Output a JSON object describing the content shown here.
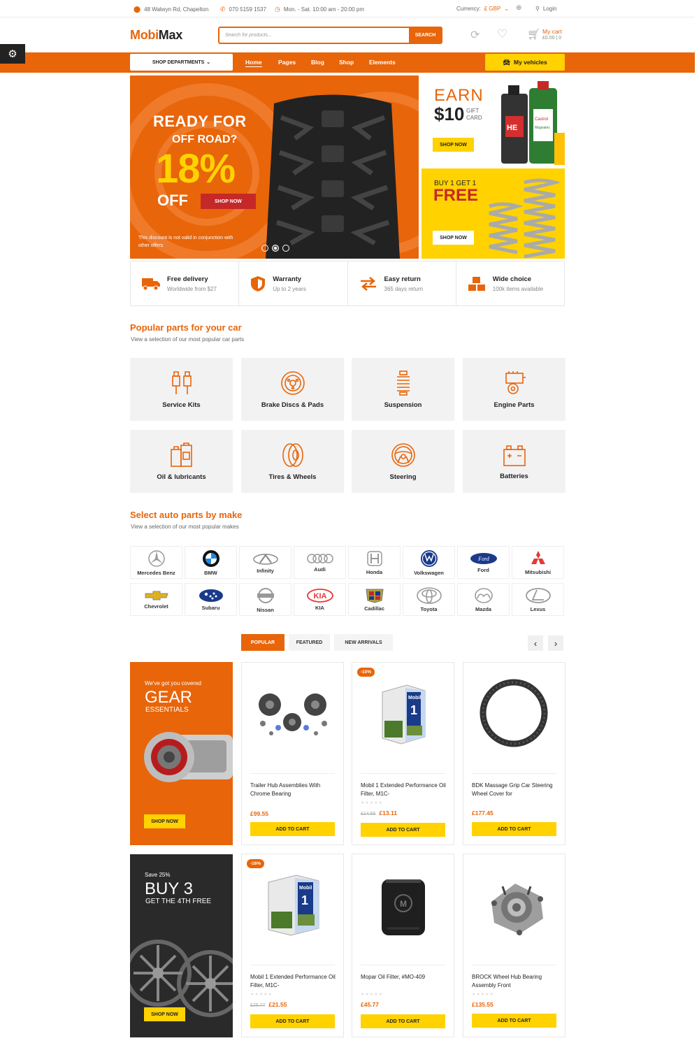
{
  "topbar": {
    "address": "48 Walwyn Rd, Chapelton",
    "phone": "070 5159 1537",
    "hours": "Mon. - Sat. 10:00 am - 20:00 pm",
    "currency_label": "Currency:",
    "currency_value": "£ GBP",
    "login": "Login"
  },
  "header": {
    "logo_a": "Mobi",
    "logo_b": "Max",
    "search_placeholder": "Search for products...",
    "search_button": "SEARCH",
    "cart_label": "My cart",
    "cart_value": "£0.00 | 0"
  },
  "nav": {
    "departments": "SHOP DEPARTMENTS",
    "links": [
      "Home",
      "Pages",
      "Blog",
      "Shop",
      "Elements"
    ],
    "vehicles": "My vehicles"
  },
  "hero": {
    "line1": "READY FOR",
    "line2": "OFF ROAD?",
    "percent": "18%",
    "off": "OFF",
    "shop": "SHOP NOW",
    "note": "This discount is not valid in conjunction with other offers"
  },
  "banner_earn": {
    "earn": "EARN",
    "amount": "$10",
    "gift": "GIFT",
    "card": "CARD",
    "shop": "SHOP NOW"
  },
  "banner_free": {
    "buy": "BUY 1 GET 1",
    "free": "FREE",
    "shop": "SHOP NOW"
  },
  "features": [
    {
      "title": "Free delivery",
      "sub": "Worldwide from $27"
    },
    {
      "title": "Warranty",
      "sub": "Up to 2 years"
    },
    {
      "title": "Easy return",
      "sub": "365 days return"
    },
    {
      "title": "Wide choice",
      "sub": "100k items available"
    }
  ],
  "popular": {
    "title": "Popular parts for your car",
    "subtitle": "View a selection of our most popular car parts",
    "categories": [
      "Service Kits",
      "Brake Discs & Pads",
      "Suspension",
      "Engine Parts",
      "Oil & lubricants",
      "Tires & Wheels",
      "Steering",
      "Batteries"
    ]
  },
  "makes": {
    "title": "Select auto parts by make",
    "subtitle": "View a selection of our most popular makes",
    "items": [
      "Mercedes Benz",
      "BMW",
      "Infinity",
      "Audi",
      "Honda",
      "Volkswagen",
      "Ford",
      "Mitsubishi",
      "Chevrolet",
      "Subaru",
      "Nissan",
      "KIA",
      "Cadillac",
      "Toyota",
      "Mazda",
      "Lexus"
    ],
    "logo_texts": {
      "ford": "Ford",
      "kia": "KIA"
    }
  },
  "tabs": [
    "POPULAR",
    "FEATURED",
    "NEW ARRIVALS"
  ],
  "arrows": {
    "prev": "‹",
    "next": "›"
  },
  "promo_gear": {
    "kicker": "We've got you covered",
    "title": "GEAR",
    "sub": "ESSENTIALS",
    "shop": "SHOP NOW"
  },
  "promo_buy": {
    "kicker": "Save 25%",
    "title": "BUY 3",
    "sub": "GET THE 4TH FREE",
    "shop": "SHOP NOW"
  },
  "products": [
    {
      "name": "Trailer Hub Assemblies With Chrome Bearing",
      "price": "£99.55",
      "old": "",
      "badge": "",
      "stars": ""
    },
    {
      "name": "Mobil 1 Extended Performance Oil Filter, M1C-",
      "price": "£13.11",
      "old": "£14.55",
      "badge": "-10%",
      "stars": "★★★★★"
    },
    {
      "name": "BDK Massage Grip Car Steering Wheel Cover for",
      "price": "£177.45",
      "old": "",
      "badge": "",
      "stars": ""
    },
    {
      "name": "Mobil 1 Extended Performance Oil Filter, M1C-",
      "price": "£21.55",
      "old": "£25.77",
      "badge": "-16%",
      "stars": "★★★★★"
    },
    {
      "name": "Mopar Oil Filter, #MO-409",
      "price": "£45.77",
      "old": "",
      "badge": "",
      "stars": "★★★★★"
    },
    {
      "name": "BROCK Wheel Hub Bearing Assembly Front",
      "price": "£135.55",
      "old": "",
      "badge": "",
      "stars": "★★★★★"
    }
  ],
  "add_to_cart": "ADD TO CART",
  "product_labels": {
    "mobil": "Mobil",
    "mobil_one": "1",
    "mopar": "M"
  },
  "oil_labels": {
    "hel": "HE",
    "castrol": "Castrol",
    "mag": "Magnatec"
  },
  "colors": {
    "accent": "#e8650a",
    "yellow": "#ffd200",
    "red": "#c62828"
  }
}
